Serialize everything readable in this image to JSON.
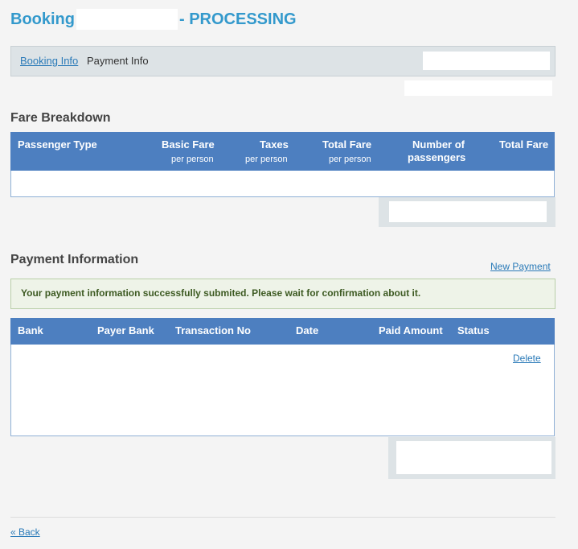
{
  "header": {
    "prefix": "Booking",
    "status": "- PROCESSING"
  },
  "tabs": {
    "booking_info": "Booking Info",
    "payment_info": "Payment Info"
  },
  "fare": {
    "heading": "Fare Breakdown",
    "columns": {
      "passenger_type": "Passenger Type",
      "basic_fare": "Basic Fare",
      "basic_fare_sub": "per person",
      "taxes": "Taxes",
      "taxes_sub": "per person",
      "total_fare_pp": "Total Fare",
      "total_fare_pp_sub": "per person",
      "num_passengers_1": "Number of",
      "num_passengers_2": "passengers",
      "total_fare": "Total Fare"
    }
  },
  "payment": {
    "heading": "Payment Information",
    "new_payment": "New Payment",
    "message": "Your payment information successfully submited. Please wait for confirmation about it.",
    "columns": {
      "bank": "Bank",
      "payer_bank": "Payer Bank",
      "transaction_no": "Transaction No",
      "date": "Date",
      "paid_amount": "Paid Amount",
      "status": "Status"
    },
    "delete": "Delete"
  },
  "footer": {
    "back": "« Back"
  },
  "colors": {
    "title": "#3399cc",
    "table_header": "#4d7fc0",
    "link": "#2a7ab8",
    "success_bg": "#eef3e8"
  }
}
